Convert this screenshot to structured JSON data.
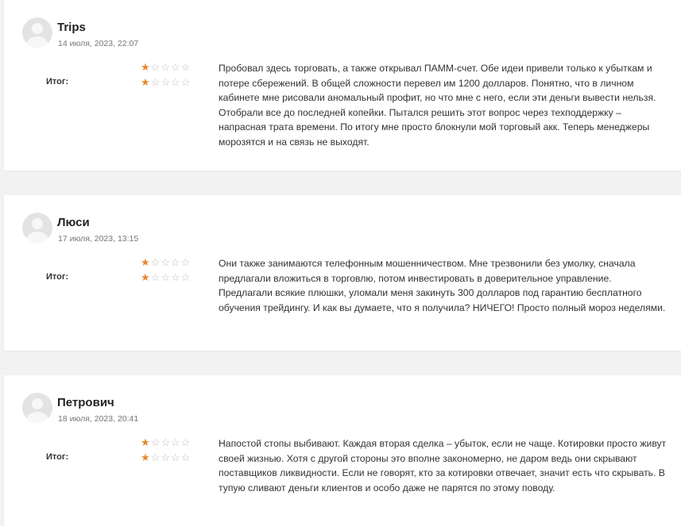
{
  "reviews": [
    {
      "author": "Trips",
      "date": "14 июля, 2023, 22:07",
      "rating_row1": 1,
      "rating_row2": 1,
      "max_rating": 5,
      "total_label": "Итог:",
      "text": "Пробовал здесь торговать, а также открывал ПАММ-счет. Обе идеи привели только к убыткам и потере сбережений. В общей сложности перевел им 1200 долларов. Понятно, что в личном кабинете мне рисовали аномальный профит, но что мне с него, если эти деньги вывести нельзя. Отобрали все до последней копейки. Пытался решить этот вопрос через техподдержку – напрасная трата времени. По итогу мне просто блокнули мой торговый акк. Теперь менеджеры морозятся и на связь не выходят."
    },
    {
      "author": "Люси",
      "date": "17 июля, 2023, 13:15",
      "rating_row1": 1,
      "rating_row2": 1,
      "max_rating": 5,
      "total_label": "Итог:",
      "text": "Они также занимаются телефонным мошенничеством. Мне трезвонили без умолку, сначала предлагали вложиться в торговлю, потом инвестировать в доверительное управление. Предлагали всякие плюшки, уломали меня закинуть 300 долларов под гарантию бесплатного обучения трейдингу. И как вы думаете, что я получила? НИЧЕГО! Просто полный мороз неделями."
    },
    {
      "author": "Петрович",
      "date": "18 июля, 2023, 20:41",
      "rating_row1": 1,
      "rating_row2": 1,
      "max_rating": 5,
      "total_label": "Итог:",
      "text": "Напостой стопы выбивают. Каждая вторая сделка – убыток, если не чаще. Котировки просто живут своей жизнью. Хотя с другой стороны это вполне закономерно, не даром ведь они скрывают поставщиков ликвидности. Если не говорят, кто за котировки отвечает, значит есть что скрывать. В тупую сливают деньги клиентов и особо даже не парятся по этому поводу."
    }
  ],
  "colors": {
    "star_active": "#e8872d",
    "star_inactive": "#bdbdbd",
    "card_background": "#ffffff",
    "page_background": "#f2f2f2"
  },
  "icons": {
    "avatar": "default-user-avatar-icon",
    "star": "star-icon"
  }
}
